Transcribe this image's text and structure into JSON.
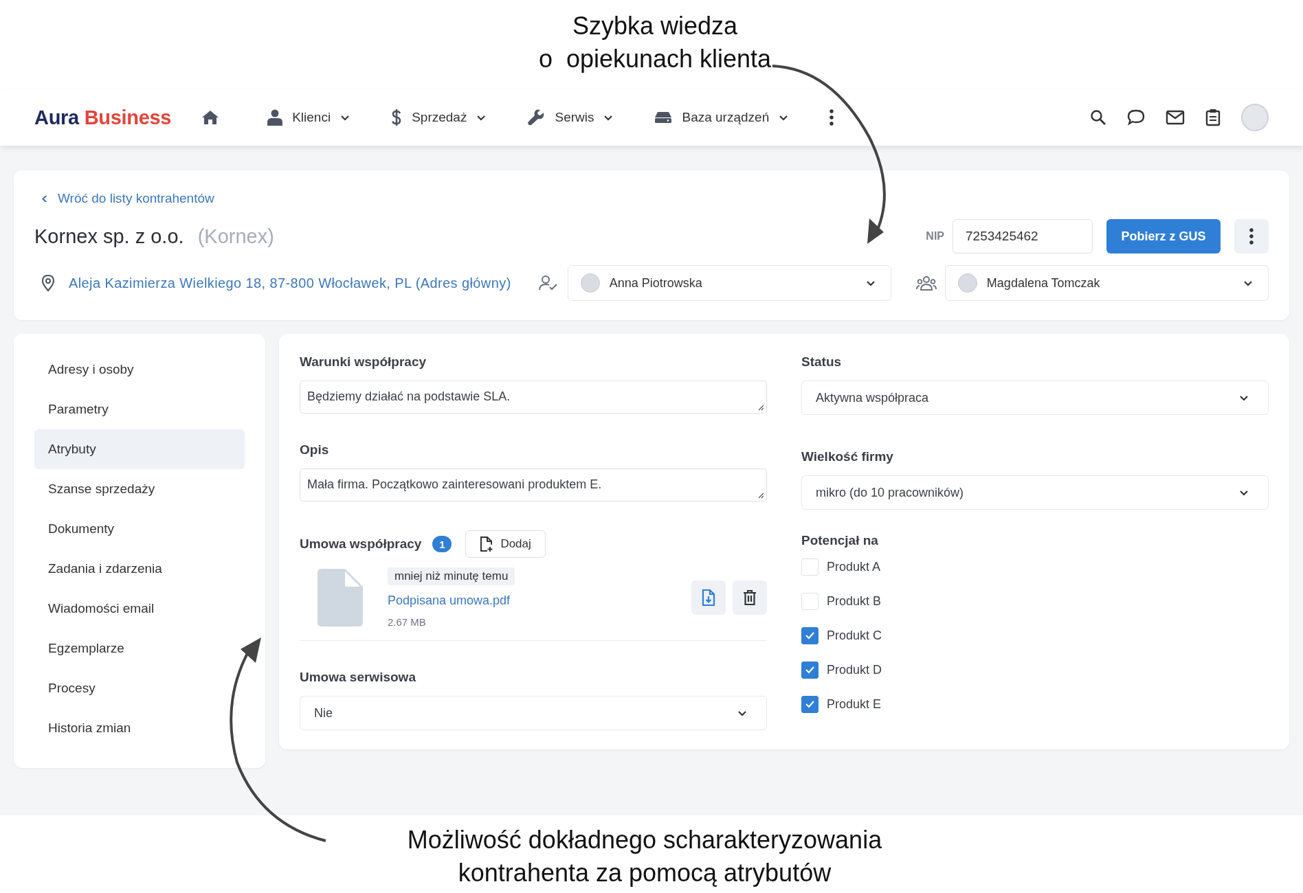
{
  "annotations": [
    {
      "text": "Szybka wiedza\no  opiekunach klienta"
    },
    {
      "text": "Możliwość dokładnego scharakteryzowania\nkontrahenta za pomocą atrybutów"
    }
  ],
  "nav": {
    "logo": {
      "part_1": "Aura",
      "part_2": "Business"
    },
    "items": [
      {
        "label": "Klienci"
      },
      {
        "label": "Sprzedaż"
      },
      {
        "label": "Serwis"
      },
      {
        "label": "Baza urządzeń"
      }
    ]
  },
  "header": {
    "back_link": "Wróć do listy kontrahentów",
    "name": "Kornex sp. z o.o.",
    "short_name": "(Kornex)",
    "nip_label": "NIP",
    "nip_value": "7253425462",
    "fetch_button": "Pobierz z GUS",
    "address": "Aleja Kazimierza Wielkiego 18, 87-800 Włocławek, PL (Adres główny)",
    "account_manager": "Anna Piotrowska",
    "team_member": "Magdalena Tomczak"
  },
  "sidebar": {
    "items": [
      {
        "label": "Adresy i osoby",
        "selected": false
      },
      {
        "label": "Parametry",
        "selected": false
      },
      {
        "label": "Atrybuty",
        "selected": true
      },
      {
        "label": "Szanse sprzedaży",
        "selected": false
      },
      {
        "label": "Dokumenty",
        "selected": false
      },
      {
        "label": "Zadania i zdarzenia",
        "selected": false
      },
      {
        "label": "Wiadomości email",
        "selected": false
      },
      {
        "label": "Egzemplarze",
        "selected": false
      },
      {
        "label": "Procesy",
        "selected": false
      },
      {
        "label": "Historia zmian",
        "selected": false
      }
    ]
  },
  "form": {
    "terms": {
      "label": "Warunki współpracy",
      "value": "Będziemy działać na podstawie SLA."
    },
    "description": {
      "label": "Opis",
      "value": "Mała firma. Początkowo zainteresowani produktem E."
    },
    "contract": {
      "label": "Umowa współpracy",
      "count": "1",
      "add_button": "Dodaj",
      "file": {
        "time": "mniej niż minutę temu",
        "name": "Podpisana umowa.pdf",
        "size": "2.67 MB"
      }
    },
    "service_contract": {
      "label": "Umowa serwisowa",
      "value": "Nie"
    },
    "status": {
      "label": "Status",
      "value": "Aktywna współpraca"
    },
    "company_size": {
      "label": "Wielkość firmy",
      "value": "mikro (do 10 pracowników)"
    },
    "potential": {
      "label": "Potencjał na",
      "options": [
        {
          "label": "Produkt A",
          "checked": false
        },
        {
          "label": "Produkt B",
          "checked": false
        },
        {
          "label": "Produkt C",
          "checked": true
        },
        {
          "label": "Produkt D",
          "checked": true
        },
        {
          "label": "Produkt E",
          "checked": true
        }
      ]
    }
  }
}
